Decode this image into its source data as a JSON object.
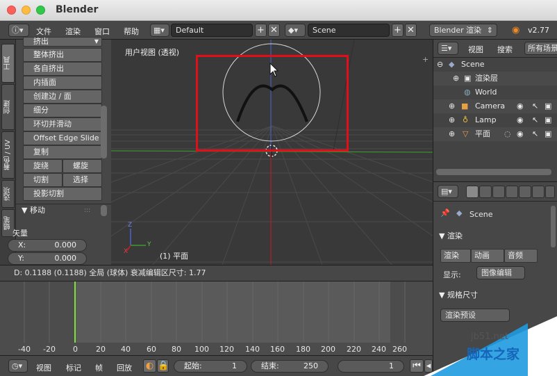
{
  "window": {
    "title": "Blender"
  },
  "info_header": {
    "menus": [
      "文件",
      "渲染",
      "窗口",
      "帮助"
    ],
    "layout": "Default",
    "scene": "Scene",
    "engine": "Blender 渲染",
    "version": "v2.77"
  },
  "tool_tabs": [
    "工具",
    "创建",
    "着色 / UV",
    "选项",
    "蜡笔"
  ],
  "tools": {
    "header": "挤出",
    "buttons": [
      "整体挤出",
      "各自挤出",
      "内插面",
      "创建边 / 面",
      "细分",
      "环切并滑动",
      "Offset Edge Slide",
      "复制"
    ],
    "pairs": [
      [
        "旋绕",
        "螺旋"
      ],
      [
        "切割",
        "选择"
      ]
    ],
    "last": "投影切割"
  },
  "operator": {
    "title": "移动",
    "vector_label": "矢量",
    "x_label": "X:",
    "x_value": "0.000",
    "y_label": "Y:",
    "y_value": "0.000"
  },
  "viewport": {
    "label": "用户视图 (透视)",
    "object": "(1) 平面",
    "axis_x": "X",
    "axis_y": "Y",
    "axis_z": "Z"
  },
  "status_line": "D: 0.1188 (0.1188) 全局 (球体) 衰减编辑区尺寸: 1.77",
  "timeline": {
    "ticks": [
      "-40",
      "-20",
      "0",
      "20",
      "40",
      "60",
      "80",
      "100",
      "120",
      "140",
      "160",
      "180",
      "200",
      "220",
      "240",
      "260"
    ],
    "current_frame_marker": 0
  },
  "timeline_header": {
    "menus": [
      "视图",
      "标记",
      "帧",
      "回放"
    ],
    "start_label": "起始:",
    "start_value": "1",
    "end_label": "结束:",
    "end_value": "250",
    "current_value": "1"
  },
  "outliner": {
    "view": "视图",
    "search": "搜索",
    "filter": "所有场景",
    "rows": [
      {
        "label": "Scene",
        "icon": "scene-icon"
      },
      {
        "label": "渲染层",
        "icon": "render-layer-icon"
      },
      {
        "label": "World",
        "icon": "world-icon"
      },
      {
        "label": "Camera",
        "icon": "camera-icon"
      },
      {
        "label": "Lamp",
        "icon": "lamp-icon"
      },
      {
        "label": "平面",
        "icon": "mesh-icon"
      }
    ]
  },
  "properties": {
    "scene": "Scene",
    "render_section": "渲染",
    "render_btn": "渲染",
    "anim_btn": "动画",
    "audio_btn": "音频",
    "display_label": "显示:",
    "display_value": "图像编辑",
    "dimensions_section": "规格尺寸",
    "preset": "渲染预设"
  },
  "watermark": {
    "site": "jb51.net",
    "name": "脚本之家"
  },
  "colors": {
    "accent": "#e30f18",
    "frame_line": "#7ee03a",
    "axis_red": "#c02020",
    "axis_green": "#3a9a2a",
    "axis_blue": "#3b5fd9"
  }
}
